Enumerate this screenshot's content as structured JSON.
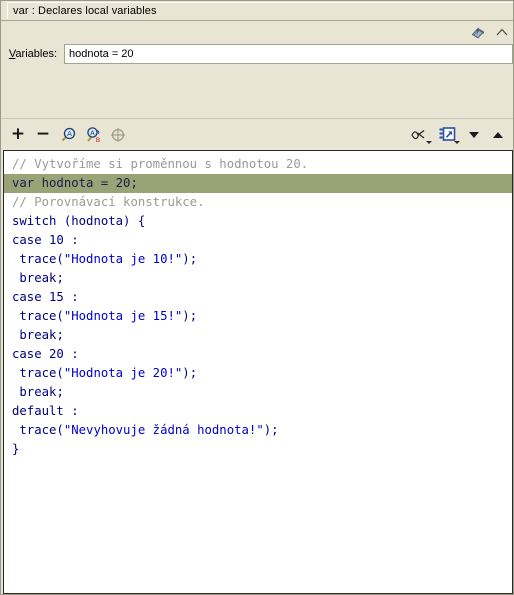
{
  "window": {
    "title": "var : Declares local variables"
  },
  "params_panel": {
    "help_icon": "book-help-icon",
    "collapse_icon": "collapse-arrow-icon",
    "variables_label": "Variables:",
    "variables_label_accel": "V",
    "variables_label_rest": "ariables:",
    "variables_value": "hodnota = 20",
    "variables_placeholder": ""
  },
  "toolbar": {
    "left_buttons": [
      {
        "name": "add-statement-button",
        "icon": "plus-icon",
        "label": "+"
      },
      {
        "name": "remove-statement-button",
        "icon": "minus-icon",
        "label": "−"
      },
      {
        "name": "find-button",
        "icon": "magnifier-find-icon",
        "label": ""
      },
      {
        "name": "find-replace-button",
        "icon": "magnifier-replace-icon",
        "label": ""
      },
      {
        "name": "insert-target-path-button",
        "icon": "target-crosshair-icon",
        "label": ""
      }
    ],
    "right_buttons": [
      {
        "name": "check-syntax-button",
        "icon": "syntax-check-icon",
        "label": ""
      },
      {
        "name": "options-menu-button",
        "icon": "script-export-icon",
        "label": ""
      },
      {
        "name": "move-down-button",
        "icon": "triangle-down-icon",
        "label": ""
      },
      {
        "name": "move-up-button",
        "icon": "triangle-up-icon",
        "label": ""
      }
    ]
  },
  "editor": {
    "lines": [
      {
        "segments": [
          {
            "cls": "cmt",
            "text": "// Vytvoříme si proměnnou s hodnotou 20."
          }
        ],
        "highlighted": false
      },
      {
        "segments": [
          {
            "cls": "kw",
            "text": "var hodnota = 20;"
          }
        ],
        "highlighted": true
      },
      {
        "segments": [
          {
            "cls": "cmt",
            "text": "// Porovnávací konstrukce."
          }
        ],
        "highlighted": false
      },
      {
        "segments": [
          {
            "cls": "kw",
            "text": "switch"
          },
          {
            "cls": "plain",
            "text": " (hodnota) {"
          }
        ],
        "highlighted": false
      },
      {
        "segments": [
          {
            "cls": "kw",
            "text": "case"
          },
          {
            "cls": "plain",
            "text": " 10 :"
          }
        ],
        "highlighted": false
      },
      {
        "segments": [
          {
            "cls": "plain",
            "text": " trace("
          },
          {
            "cls": "str",
            "text": "\"Hodnota je 10!\""
          },
          {
            "cls": "plain",
            "text": ");"
          }
        ],
        "highlighted": false
      },
      {
        "segments": [
          {
            "cls": "plain",
            "text": " "
          },
          {
            "cls": "kw",
            "text": "break"
          },
          {
            "cls": "plain",
            "text": ";"
          }
        ],
        "highlighted": false
      },
      {
        "segments": [
          {
            "cls": "kw",
            "text": "case"
          },
          {
            "cls": "plain",
            "text": " 15 :"
          }
        ],
        "highlighted": false
      },
      {
        "segments": [
          {
            "cls": "plain",
            "text": " trace("
          },
          {
            "cls": "str",
            "text": "\"Hodnota je 15!\""
          },
          {
            "cls": "plain",
            "text": ");"
          }
        ],
        "highlighted": false
      },
      {
        "segments": [
          {
            "cls": "plain",
            "text": " "
          },
          {
            "cls": "kw",
            "text": "break"
          },
          {
            "cls": "plain",
            "text": ";"
          }
        ],
        "highlighted": false
      },
      {
        "segments": [
          {
            "cls": "kw",
            "text": "case"
          },
          {
            "cls": "plain",
            "text": " 20 :"
          }
        ],
        "highlighted": false
      },
      {
        "segments": [
          {
            "cls": "plain",
            "text": " trace("
          },
          {
            "cls": "str",
            "text": "\"Hodnota je 20!\""
          },
          {
            "cls": "plain",
            "text": ");"
          }
        ],
        "highlighted": false
      },
      {
        "segments": [
          {
            "cls": "plain",
            "text": " "
          },
          {
            "cls": "kw",
            "text": "break"
          },
          {
            "cls": "plain",
            "text": ";"
          }
        ],
        "highlighted": false
      },
      {
        "segments": [
          {
            "cls": "kw",
            "text": "default"
          },
          {
            "cls": "plain",
            "text": " :"
          }
        ],
        "highlighted": false
      },
      {
        "segments": [
          {
            "cls": "plain",
            "text": " trace("
          },
          {
            "cls": "str",
            "text": "\"Nevyhovuje žádná hodnota!\""
          },
          {
            "cls": "plain",
            "text": ");"
          }
        ],
        "highlighted": false
      },
      {
        "segments": [
          {
            "cls": "plain",
            "text": "}"
          }
        ],
        "highlighted": false
      }
    ]
  },
  "colors": {
    "panel_background": "#E8E5D4",
    "editor_background": "#ffffff",
    "highlight_line": "#99a375",
    "comment": "#9a9a9a",
    "keyword": "#000080",
    "string": "#0000cc",
    "input_border": "#9fa68c"
  }
}
